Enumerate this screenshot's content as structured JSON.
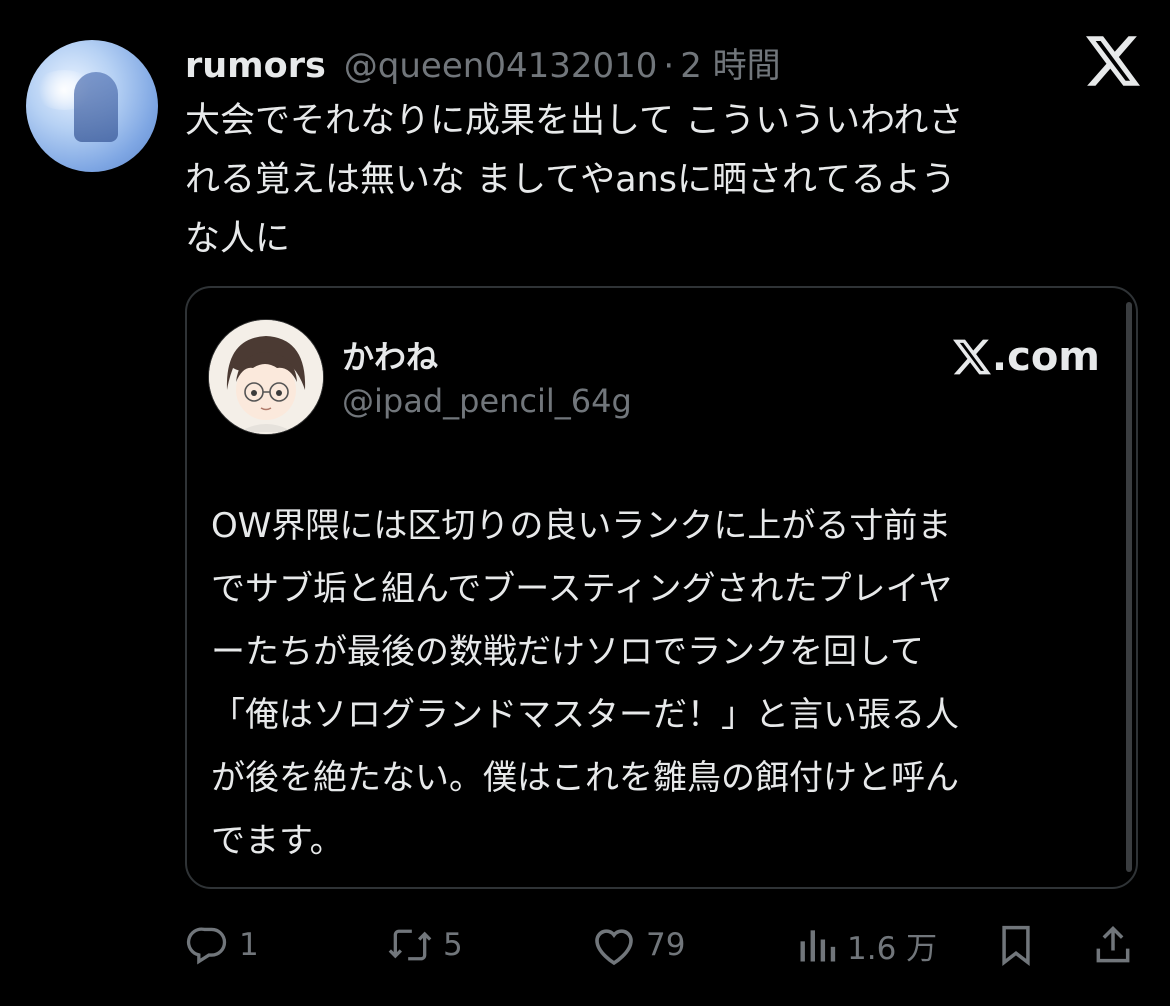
{
  "post": {
    "author_name": "rumors",
    "handle": "@queen04132010",
    "separator": "·",
    "time": "2 時間",
    "text": "大会でそれなりに成果を出して こういういわれさ\nれる覚えは無いな ましてやansに晒されてるよう\nな人に"
  },
  "quoted": {
    "name": "かわね",
    "handle": "@ipad_pencil_64g",
    "site": ".com",
    "text": "OW界隈には区切りの良いランクに上がる寸前ま\nでサブ垢と組んでブースティングされたプレイヤ\nーたちが最後の数戦だけソロでランクを回して\n「俺はソログランドマスターだ！」と言い張る人\nが後を絶たない。僕はこれを雛鳥の餌付けと呼ん\nでます。"
  },
  "actions": {
    "reply_count": "1",
    "repost_count": "5",
    "like_count": "79",
    "views_count": "1.6 万"
  },
  "icons": {
    "top_logo": "x-logo-icon",
    "reply": "reply-icon",
    "repost": "repost-icon",
    "like": "heart-icon",
    "views": "views-icon",
    "bookmark": "bookmark-icon",
    "share": "share-icon"
  },
  "colors": {
    "background": "#000000",
    "text": "#e7e9ea",
    "muted": "#71767b",
    "border": "#2f3336"
  }
}
